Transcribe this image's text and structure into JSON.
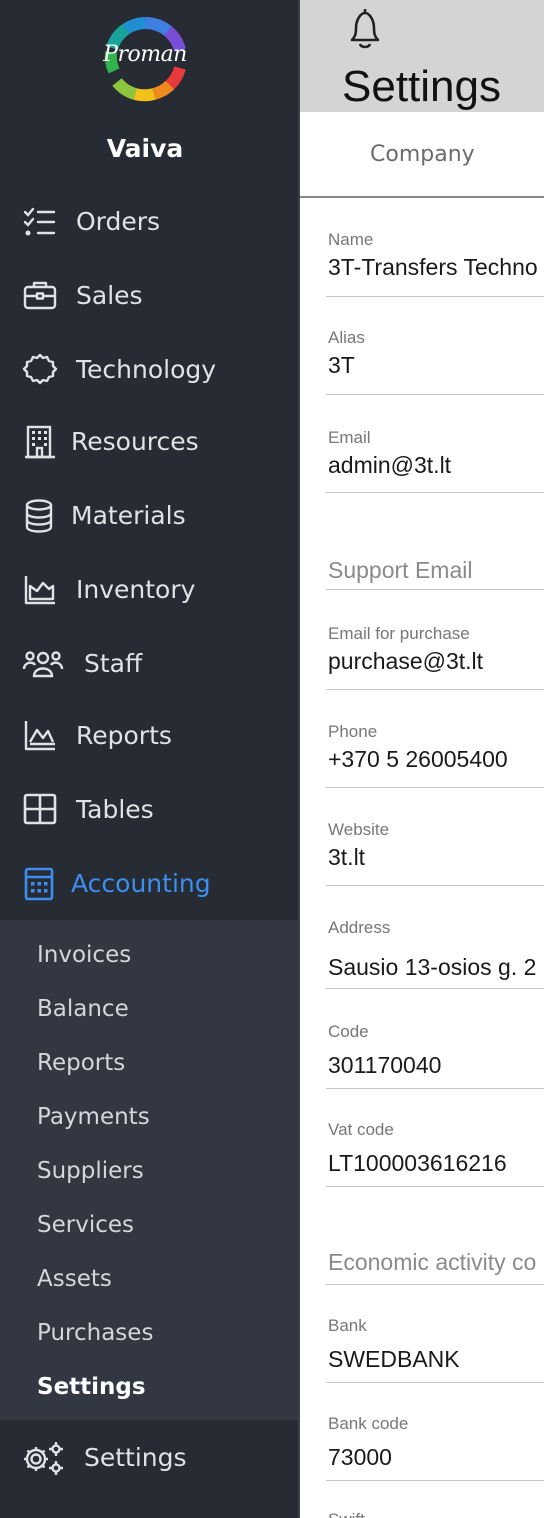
{
  "sidebar": {
    "logo_text": "Proman",
    "user_name": "Vaiva",
    "items": [
      {
        "label": "Orders",
        "icon": "list-check-icon"
      },
      {
        "label": "Sales",
        "icon": "briefcase-icon"
      },
      {
        "label": "Technology",
        "icon": "gear-outline-icon"
      },
      {
        "label": "Resources",
        "icon": "building-icon"
      },
      {
        "label": "Materials",
        "icon": "database-icon"
      },
      {
        "label": "Inventory",
        "icon": "chart-area-icon"
      },
      {
        "label": "Staff",
        "icon": "users-icon"
      },
      {
        "label": "Reports",
        "icon": "chart-line-icon"
      },
      {
        "label": "Tables",
        "icon": "table-icon"
      },
      {
        "label": "Accounting",
        "icon": "calculator-icon"
      }
    ],
    "accounting_submenu": [
      "Invoices",
      "Balance",
      "Reports",
      "Payments",
      "Suppliers",
      "Services",
      "Assets",
      "Purchases",
      "Settings"
    ],
    "active_submenu": "Settings",
    "bottom_item": {
      "label": "Settings",
      "icon": "gears-icon"
    }
  },
  "header": {
    "title": "Settings",
    "tab": "Company"
  },
  "form": {
    "name": {
      "label": "Name",
      "value": "3T-Transfers Techno"
    },
    "alias": {
      "label": "Alias",
      "value": "3T"
    },
    "email": {
      "label": "Email",
      "value": "admin@3t.lt"
    },
    "support_email": {
      "placeholder": "Support Email"
    },
    "purchase_email": {
      "label": "Email for purchase",
      "value": "purchase@3t.lt"
    },
    "phone": {
      "label": "Phone",
      "value": "+370 5 26005400"
    },
    "website": {
      "label": "Website",
      "value": "3t.lt"
    },
    "address": {
      "label": "Address",
      "value": "Sausio 13-osios g. 2"
    },
    "code": {
      "label": "Code",
      "value": "301170040"
    },
    "vat_code": {
      "label": "Vat code",
      "value": "LT100003616216"
    },
    "economic_activity": {
      "placeholder": "Economic activity co"
    },
    "bank": {
      "label": "Bank",
      "value": "SWEDBANK"
    },
    "bank_code": {
      "label": "Bank code",
      "value": "73000"
    },
    "swift": {
      "label": "Swift"
    }
  },
  "colors": {
    "sidebar_bg": "#272b33",
    "submenu_bg": "#323742",
    "accent": "#3d8ef0",
    "topbar_bg": "#d4d4d4"
  }
}
